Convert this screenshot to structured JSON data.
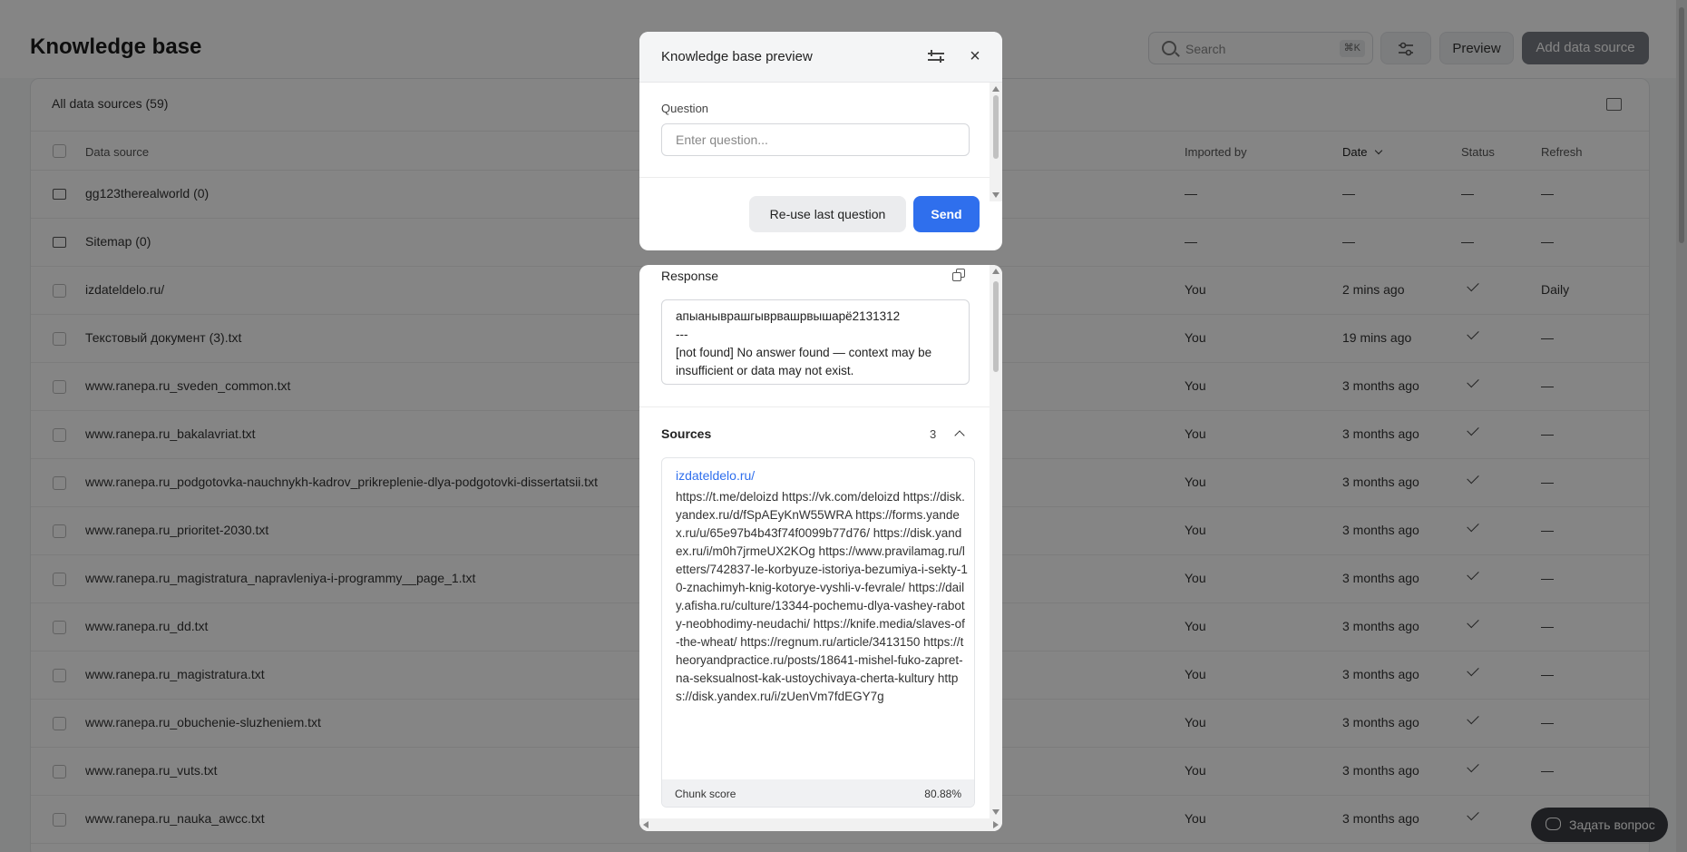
{
  "header": {
    "title": "Knowledge base",
    "search_placeholder": "Search",
    "search_shortcut": "⌘K",
    "preview_label": "Preview",
    "add_label": "Add data source"
  },
  "panel": {
    "title": "All data sources (59)",
    "columns": {
      "source": "Data source",
      "imported_by": "Imported by",
      "date": "Date",
      "status": "Status",
      "refresh": "Refresh"
    }
  },
  "rows": [
    {
      "name": "gg123therealworld (0)",
      "type": "folder",
      "imported_by": "—",
      "date": "—",
      "status": "—",
      "refresh": "—"
    },
    {
      "name": "Sitemap (0)",
      "type": "folder",
      "imported_by": "—",
      "date": "—",
      "status": "—",
      "refresh": "—"
    },
    {
      "name": "izdateldelo.ru/",
      "type": "file",
      "imported_by": "You",
      "date": "2 mins ago",
      "status": "check",
      "refresh": "Daily"
    },
    {
      "name": "Текстовый документ (3).txt",
      "type": "file",
      "imported_by": "You",
      "date": "19 mins ago",
      "status": "check",
      "refresh": "—"
    },
    {
      "name": "www.ranepa.ru_sveden_common.txt",
      "type": "file",
      "imported_by": "You",
      "date": "3 months ago",
      "status": "check",
      "refresh": "—"
    },
    {
      "name": "www.ranepa.ru_bakalavriat.txt",
      "type": "file",
      "imported_by": "You",
      "date": "3 months ago",
      "status": "check",
      "refresh": "—"
    },
    {
      "name": "www.ranepa.ru_podgotovka-nauchnykh-kadrov_prikreplenie-dlya-podgotovki-dissertatsii.txt",
      "type": "file",
      "imported_by": "You",
      "date": "3 months ago",
      "status": "check",
      "refresh": "—"
    },
    {
      "name": "www.ranepa.ru_prioritet-2030.txt",
      "type": "file",
      "imported_by": "You",
      "date": "3 months ago",
      "status": "check",
      "refresh": "—"
    },
    {
      "name": "www.ranepa.ru_magistratura_napravleniya-i-programmy__page_1.txt",
      "type": "file",
      "imported_by": "You",
      "date": "3 months ago",
      "status": "check",
      "refresh": "—"
    },
    {
      "name": "www.ranepa.ru_dd.txt",
      "type": "file",
      "imported_by": "You",
      "date": "3 months ago",
      "status": "check",
      "refresh": "—"
    },
    {
      "name": "www.ranepa.ru_magistratura.txt",
      "type": "file",
      "imported_by": "You",
      "date": "3 months ago",
      "status": "check",
      "refresh": "—"
    },
    {
      "name": "www.ranepa.ru_obuchenie-sluzheniem.txt",
      "type": "file",
      "imported_by": "You",
      "date": "3 months ago",
      "status": "check",
      "refresh": "—"
    },
    {
      "name": "www.ranepa.ru_vuts.txt",
      "type": "file",
      "imported_by": "You",
      "date": "3 months ago",
      "status": "check",
      "refresh": "—"
    },
    {
      "name": "www.ranepa.ru_nauka_awcc.txt",
      "type": "file",
      "imported_by": "You",
      "date": "3 months ago",
      "status": "check",
      "refresh": ""
    }
  ],
  "modal": {
    "title": "Knowledge base preview",
    "question_label": "Question",
    "question_placeholder": "Enter question...",
    "reuse_label": "Re-use last question",
    "send_label": "Send",
    "response_label": "Response",
    "response_text": "апыаныврашгыврвашрвышарё2131312\n---\n[not found] No answer found — context may be insufficient or data may not exist.",
    "sources_label": "Sources",
    "sources_count": "3",
    "source": {
      "title": "izdateldelo.ru/",
      "text": "https://t.me/deloizd https://vk.com/deloizd https://disk.yandex.ru/d/fSpAEyKnW55WRA https://forms.yandex.ru/u/65e97b4b43f74f0099b77d76/ https://disk.yandex.ru/i/m0h7jrmeUX2KOg https://www.pravilamag.ru/letters/742837-le-korbyuze-istoriya-bezumiya-i-sekty-10-znachimyh-knig-kotorye-vyshli-v-fevrale/ https://daily.afisha.ru/culture/13344-pochemu-dlya-vashey-raboty-neobhodimy-neudachi/ https://knife.media/slaves-of-the-wheat/ https://regnum.ru/article/3413150 https://theoryandpractice.ru/posts/18641-mishel-fuko-zapret-na-seksualnost-kak-ustoychivaya-cherta-kultury https://disk.yandex.ru/i/zUenVm7fdEGY7g",
      "chunk_label": "Chunk score",
      "chunk_value": "80.88%"
    }
  },
  "chat_widget": {
    "label": "Задать вопрос"
  }
}
